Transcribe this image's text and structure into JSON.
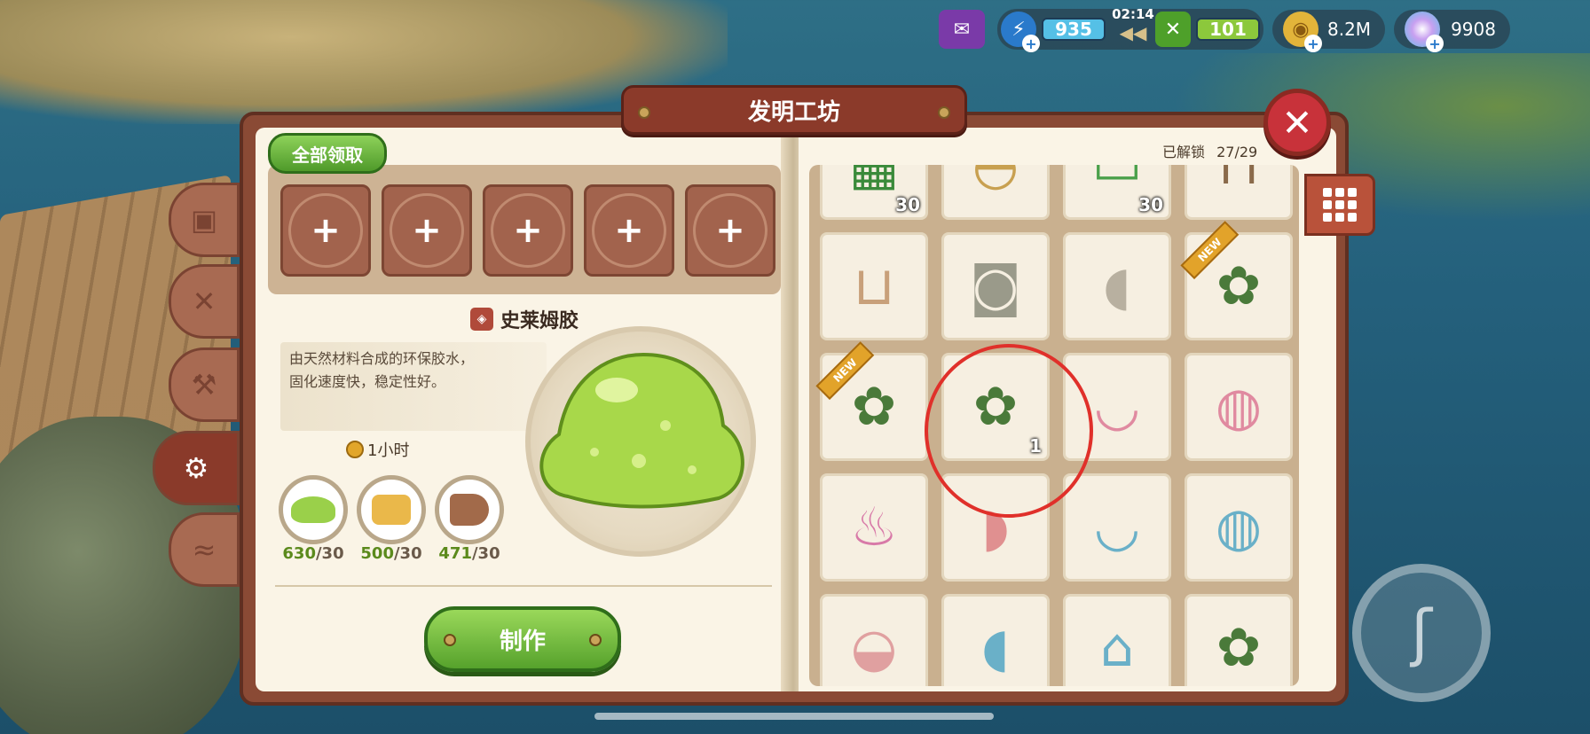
{
  "window": {
    "title": "发明工坊"
  },
  "hud": {
    "energy": "935",
    "timer": "02:14",
    "food": "101",
    "coins": "8.2M",
    "gems": "9908"
  },
  "left": {
    "claim_all_label": "全部领取",
    "slots": [
      {
        "label": "+"
      },
      {
        "label": "+"
      },
      {
        "label": "+"
      },
      {
        "label": "+"
      },
      {
        "label": "+"
      }
    ],
    "item_name": "史莱姆胶",
    "description_line1": "由天然材料合成的环保胶水，",
    "description_line2": "固化速度快，稳定性好。",
    "time": "1小时",
    "materials": [
      {
        "have": "630",
        "need": "/30"
      },
      {
        "have": "500",
        "need": "/30"
      },
      {
        "have": "471",
        "need": "/30"
      }
    ],
    "make_label": "制作"
  },
  "right": {
    "unlocked_label": "已解锁",
    "unlocked_count": "27/29",
    "items": [
      {
        "icon": "gadget-green-icon",
        "count": "30",
        "new": ""
      },
      {
        "icon": "helmet-icon",
        "count": "",
        "new": ""
      },
      {
        "icon": "board-green-icon",
        "count": "30",
        "new": ""
      },
      {
        "icon": "bench-icon",
        "count": "",
        "new": ""
      },
      {
        "icon": "sink-cabinet-icon",
        "count": "",
        "new": ""
      },
      {
        "icon": "washing-machine-icon",
        "count": "",
        "new": ""
      },
      {
        "icon": "toilet-icon",
        "count": "",
        "new": ""
      },
      {
        "icon": "plant-robot-icon",
        "count": "",
        "new": "NEW"
      },
      {
        "icon": "plant-robot-icon",
        "count": "",
        "new": "NEW"
      },
      {
        "icon": "plant-robot-icon",
        "count": "1",
        "new": ""
      },
      {
        "icon": "bathtub-pink-icon",
        "count": "",
        "new": ""
      },
      {
        "icon": "vanity-pink-icon",
        "count": "",
        "new": ""
      },
      {
        "icon": "cupcake-icon",
        "count": "",
        "new": ""
      },
      {
        "icon": "toilet-pink-icon",
        "count": "",
        "new": ""
      },
      {
        "icon": "bathtub-blue-icon",
        "count": "",
        "new": ""
      },
      {
        "icon": "vanity-blue-icon",
        "count": "",
        "new": ""
      },
      {
        "icon": "cake-icon",
        "count": "",
        "new": ""
      },
      {
        "icon": "toilet-blue-icon",
        "count": "",
        "new": ""
      },
      {
        "icon": "tub-frame-icon",
        "count": "",
        "new": ""
      },
      {
        "icon": "plant-robot-icon",
        "count": "",
        "new": ""
      }
    ]
  },
  "colors": {
    "accent": "#8b3a2a",
    "green": "#56a22c",
    "highlight": "#e0302a"
  }
}
